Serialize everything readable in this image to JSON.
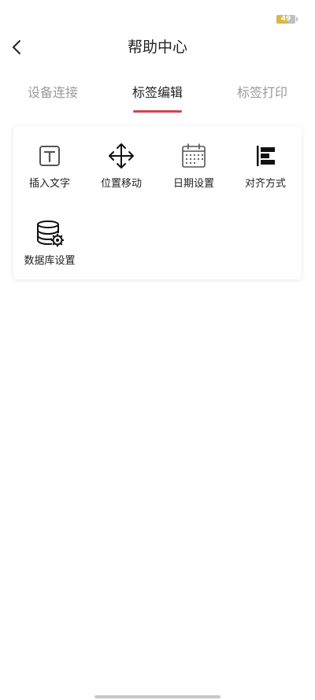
{
  "status_bar": {
    "battery_level": "49"
  },
  "header": {
    "title": "帮助中心",
    "back_icon": "chevron-left-icon"
  },
  "tabs": [
    {
      "label": "设备连接",
      "active": false
    },
    {
      "label": "标签编辑",
      "active": true
    },
    {
      "label": "标签打印",
      "active": false
    }
  ],
  "accent_color": "#d1434f",
  "items": [
    {
      "label": "插入文字",
      "icon": "text-box-icon"
    },
    {
      "label": "位置移动",
      "icon": "move-arrows-icon"
    },
    {
      "label": "日期设置",
      "icon": "calendar-icon"
    },
    {
      "label": "对齐方式",
      "icon": "align-left-icon"
    },
    {
      "label": "数据库设置",
      "icon": "database-settings-icon"
    }
  ]
}
